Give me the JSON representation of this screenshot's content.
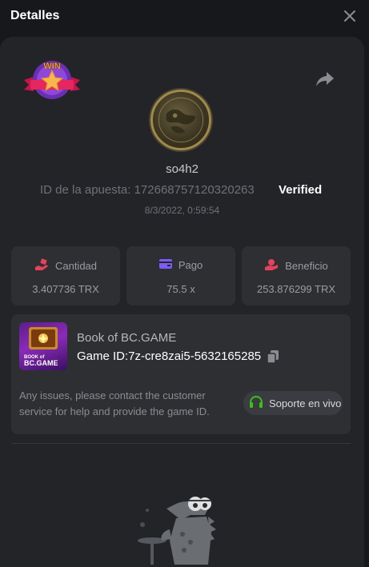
{
  "header": {
    "title": "Detalles",
    "close_icon": "close-icon"
  },
  "bet": {
    "badge": "WIN",
    "username": "so4h2",
    "bet_id": "ID de la apuesta: 172668757120320263",
    "verified": "Verified",
    "datetime": "8/3/2022, 0:59:54"
  },
  "stats": [
    {
      "label": "Cantidad",
      "value": "3.407736 TRX",
      "icon": "hand-money-icon",
      "color": "#e8415a"
    },
    {
      "label": "Pago",
      "value": "75.5 x",
      "icon": "wallet-icon",
      "color": "#7b5cf5"
    },
    {
      "label": "Beneficio",
      "value": "253.876299 TRX",
      "icon": "profit-hand-icon",
      "color": "#e8415a"
    }
  ],
  "game": {
    "name": "Book of BC.GAME",
    "thumb_title": "BOOK of",
    "thumb_brand": "BC.GAME",
    "game_id": "Game ID:7z-cre8zai5-5632165285",
    "issue_text": "Any issues, please contact the customer service for help and provide the game ID.",
    "support_label": "Soporte en vivo",
    "support_icon_color": "#3bc117"
  }
}
